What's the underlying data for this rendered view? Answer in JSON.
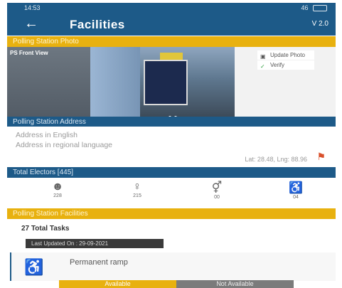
{
  "status_bar": {
    "time": "14:53",
    "right": "46"
  },
  "app_bar": {
    "title": "Facilities",
    "version": "V 2.0"
  },
  "sections": {
    "photo": "Polling Station Photo",
    "address": "Polling Station Address",
    "voters": "Total Electors [445]",
    "facilities": "Polling Station Facilities"
  },
  "photo": {
    "label": "PS Front View",
    "menu": [
      {
        "icon": "camera-icon",
        "label": "Update Photo"
      },
      {
        "icon": "check-icon",
        "label": "Verify"
      }
    ]
  },
  "address": {
    "english": "Address in English",
    "regional": "Address in regional language",
    "coords": "Lat: 28.48, Lng: 88.96"
  },
  "voters": [
    {
      "icon": "male-voter-icon",
      "count": "228"
    },
    {
      "icon": "female-voter-icon",
      "count": "215"
    },
    {
      "icon": "third-gender-icon",
      "count": "00"
    },
    {
      "icon": "pwd-voter-icon",
      "count": "04"
    }
  ],
  "tasks": {
    "title": "27 Total Tasks",
    "updated": "Last Updated On : 29-09-2021"
  },
  "facility": {
    "label": "Permanent ramp",
    "available": "Available",
    "not_available": "Not Available"
  }
}
